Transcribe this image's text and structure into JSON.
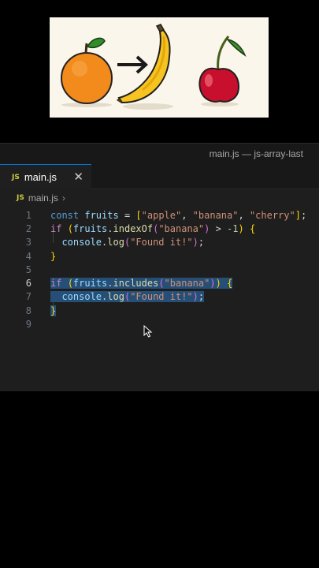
{
  "window": {
    "title": "main.js — js-array-last"
  },
  "tabs": [
    {
      "badge": "JS",
      "label": "main.js",
      "close": "✕"
    }
  ],
  "breadcrumb": {
    "badge": "JS",
    "file": "main.js",
    "separator": "›"
  },
  "line_numbers": [
    "1",
    "2",
    "3",
    "4",
    "5",
    "6",
    "7",
    "8",
    "9"
  ],
  "code": {
    "l1": {
      "kw": "const",
      "var": "fruits",
      "eq": " = ",
      "ob": "[",
      "s1": "\"apple\"",
      "s2": "\"banana\"",
      "s3": "\"cherry\"",
      "cb": "]",
      "semi": ";"
    },
    "l2": {
      "kw": "if",
      "op": "(",
      "var": "fruits",
      "fn": "indexOf",
      "op2": "(",
      "str": "\"banana\"",
      "cp": ")",
      "cmp": " > ",
      "num": "-1",
      "cp2": ")",
      "ob": "{"
    },
    "l3": {
      "obj": "console",
      "fn": "log",
      "op": "(",
      "str": "\"Found it!\"",
      "cp": ")",
      "semi": ";"
    },
    "l4": {
      "cb": "}"
    },
    "l6": {
      "kw": "if",
      "op": "(",
      "var": "fruits",
      "fn": "includes",
      "op2": "(",
      "str": "\"banana\"",
      "cp": ")",
      "cp2": ")",
      "ob": "{"
    },
    "l7": {
      "obj": "console",
      "fn": "log",
      "op": "(",
      "str": "\"Found it!\"",
      "cp": ")",
      "semi": ";"
    },
    "l8": {
      "cb": "}"
    }
  },
  "active_line": "6",
  "illustration": {
    "items": [
      "orange-icon",
      "arrow-right-icon",
      "banana-icon",
      "cherry-icon"
    ]
  },
  "colors": {
    "accent": "#0078d4",
    "editor_bg": "#1e1e1e",
    "selection": "#264f78"
  }
}
